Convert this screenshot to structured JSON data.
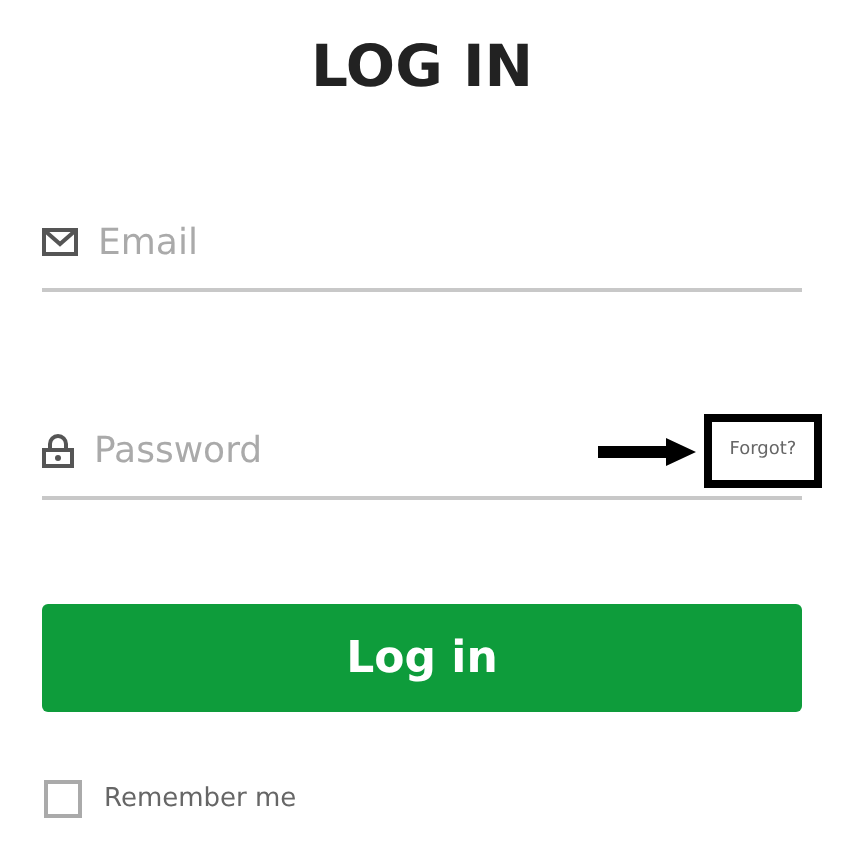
{
  "title": "LOG IN",
  "fields": [
    {
      "kind": "email",
      "placeholder": "Email"
    },
    {
      "kind": "password",
      "placeholder": "Password",
      "link": "Forgot?"
    }
  ],
  "button": "Log in",
  "remember": {
    "label": "Remember me",
    "checked": false
  }
}
